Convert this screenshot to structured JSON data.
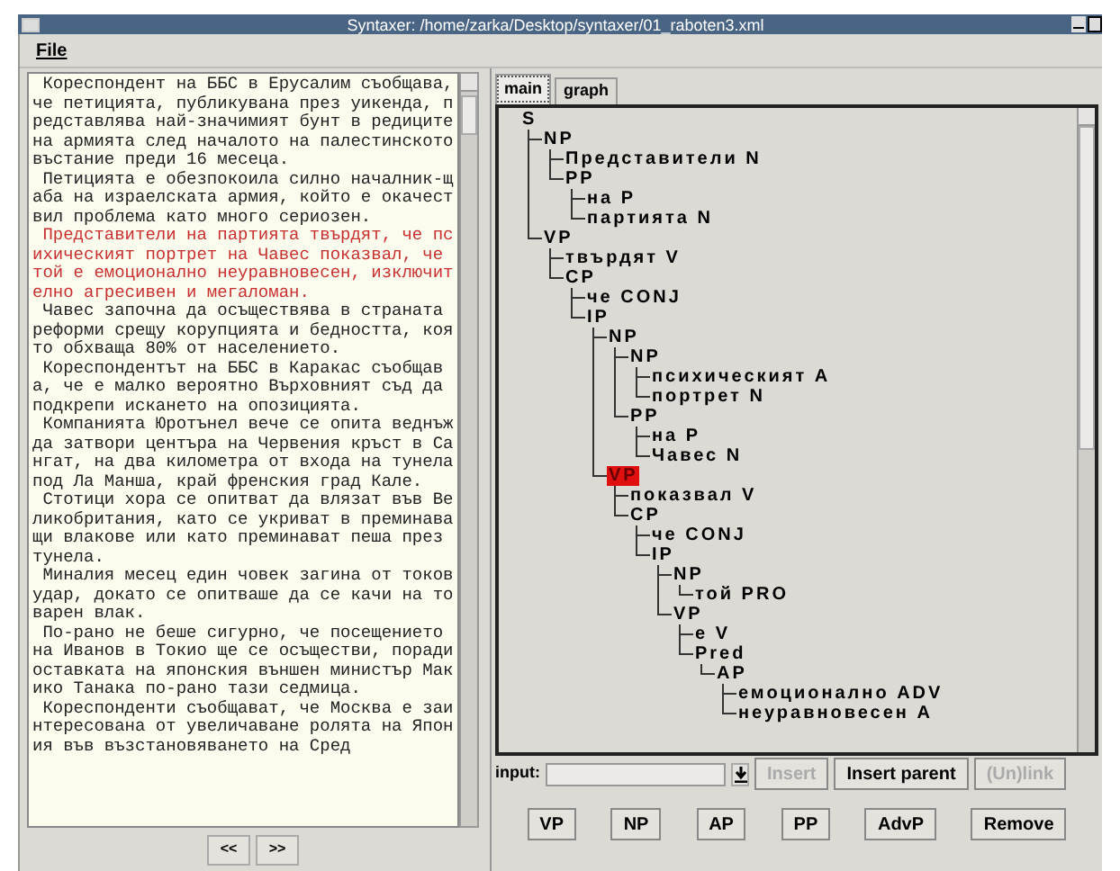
{
  "window": {
    "title": "Syntaxer:  /home/zarka/Desktop/syntaxer/01_raboten3.xml"
  },
  "menu": [
    {
      "label": "File"
    }
  ],
  "text_panel": {
    "paragraphs": [
      {
        "text": " Кореспондент на ББС в Ерусалим съобщава, че петицията, публикувана през уикенда, представлява най-значимият бунт в редиците на армията след началото на палестинското въстание преди 16 месеца.",
        "highlighted": false
      },
      {
        "text": " Петицията е обезпокоила силно началник-щаба на израелската армия, който е окачествил проблема като много сериозен.",
        "highlighted": false
      },
      {
        "text": " Представители на партията твърдят, че психическият портрет на Чавес показвал, че той е емоционално неуравновесен, изключително агресивен и мегаломан.",
        "highlighted": true
      },
      {
        "text": " Чавес започна да осъществява в страната реформи срещу корупцията и бедността, която обхваща 80% от населението.",
        "highlighted": false
      },
      {
        "text": " Кореспондентът на ББС в Каракас съобщава, че е малко вероятно Върховният съд да подкрепи искането на опозицията.",
        "highlighted": false
      },
      {
        "text": " Компанията Юротънел вече се опита веднъж да затвори центъра на Червения кръст в Сангат, на два километра от входа на тунела под Ла Манша, край френския град Кале.",
        "highlighted": false
      },
      {
        "text": " Стотици хора се опитват да влязат във Великобритания, като се укриват в преминаващи влакове или като преминават пеша през тунела.",
        "highlighted": false
      },
      {
        "text": " Миналия месец един човек загина от токов удар, докато се опитваше да се качи на товарен влак.",
        "highlighted": false
      },
      {
        "text": " По-рано не беше сигурно, че посещението на Иванов в Токио ще се осъществи, поради оставката на японския външен министър Макико Танака по-рано тази седмица.",
        "highlighted": false
      },
      {
        "text": " Кореспонденти съобщават, че Москва е заинтересована от увеличаване ролята на Япония във възстановяването на Сред",
        "highlighted": false
      }
    ]
  },
  "nav_buttons": [
    "<<",
    ">>"
  ],
  "tabs": [
    {
      "label": "main",
      "selected": true
    },
    {
      "label": "graph",
      "selected": false
    }
  ],
  "tree": {
    "label": "S",
    "selected": false,
    "children": [
      {
        "label": "NP",
        "selected": false,
        "children": [
          {
            "label": "Представители N",
            "selected": false
          },
          {
            "label": "PP",
            "selected": false,
            "children": [
              {
                "label": "на P",
                "selected": false
              },
              {
                "label": "партията N",
                "selected": false
              }
            ]
          }
        ]
      },
      {
        "label": "VP",
        "selected": false,
        "children": [
          {
            "label": "твърдят V",
            "selected": false
          },
          {
            "label": "CP",
            "selected": false,
            "children": [
              {
                "label": "че CONJ",
                "selected": false
              },
              {
                "label": "IP",
                "selected": false,
                "children": [
                  {
                    "label": "NP",
                    "selected": false,
                    "children": [
                      {
                        "label": "NP",
                        "selected": false,
                        "children": [
                          {
                            "label": "психическият A",
                            "selected": false
                          },
                          {
                            "label": "портрет N",
                            "selected": false
                          }
                        ]
                      },
                      {
                        "label": "PP",
                        "selected": false,
                        "children": [
                          {
                            "label": "на P",
                            "selected": false
                          },
                          {
                            "label": "Чавес N",
                            "selected": false
                          }
                        ]
                      }
                    ]
                  },
                  {
                    "label": "VP",
                    "selected": true,
                    "children": [
                      {
                        "label": "показвал V",
                        "selected": false
                      },
                      {
                        "label": "CP",
                        "selected": false,
                        "children": [
                          {
                            "label": "че CONJ",
                            "selected": false
                          },
                          {
                            "label": "IP",
                            "selected": false,
                            "children": [
                              {
                                "label": "NP",
                                "selected": false,
                                "children": [
                                  {
                                    "label": "той PRO",
                                    "selected": false
                                  }
                                ]
                              },
                              {
                                "label": "VP",
                                "selected": false,
                                "children": [
                                  {
                                    "label": "е V",
                                    "selected": false
                                  },
                                  {
                                    "label": "Pred",
                                    "selected": false,
                                    "children": [
                                      {
                                        "label": "AP",
                                        "selected": false,
                                        "children": [
                                          {
                                            "label": "емоционално ADV",
                                            "selected": false
                                          },
                                          {
                                            "label": "неуравновесен A",
                                            "selected": false
                                          }
                                        ]
                                      }
                                    ]
                                  }
                                ]
                              }
                            ]
                          }
                        ]
                      }
                    ]
                  }
                ]
              }
            ]
          }
        ]
      }
    ]
  },
  "input": {
    "label": "input:"
  },
  "action_buttons": [
    {
      "label": "Insert",
      "disabled": true
    },
    {
      "label": "Insert parent",
      "disabled": false
    },
    {
      "label": "(Un)link",
      "disabled": true
    }
  ],
  "phrase_buttons": [
    "VP",
    "NP",
    "AP",
    "PP",
    "AdvP",
    "Remove"
  ]
}
